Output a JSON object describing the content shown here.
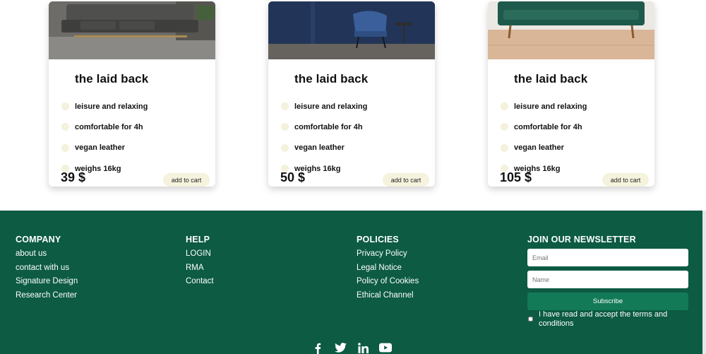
{
  "products": [
    {
      "title": "the laid back",
      "features": [
        "leisure and relaxing",
        "comfortable for 4h",
        "vegan leather",
        "weighs 16kg"
      ],
      "price": "39 $",
      "cart_label": "add to cart"
    },
    {
      "title": "the laid back",
      "features": [
        "leisure and relaxing",
        "comfortable for 4h",
        "vegan leather",
        "weighs 16kg"
      ],
      "price": "50 $",
      "cart_label": "add to cart"
    },
    {
      "title": "the laid back",
      "features": [
        "leisure and relaxing",
        "comfortable for 4h",
        "vegan leather",
        "weighs 16kg"
      ],
      "price": "105 $",
      "cart_label": "add to cart"
    }
  ],
  "footer": {
    "company": {
      "heading": "COMPANY",
      "links": [
        "about us",
        "contact with us",
        "Signature Design",
        "Research Center"
      ]
    },
    "help": {
      "heading": "HELP",
      "links": [
        "LOGIN",
        "RMA",
        "Contact"
      ]
    },
    "policies": {
      "heading": "POLICIES",
      "links": [
        "Privacy Policy",
        "Legal Notice",
        "Policy of Cookies",
        "Ethical Channel"
      ]
    },
    "newsletter": {
      "heading": "JOIN OUR NEWSLETTER",
      "email_placeholder": "Email",
      "name_placeholder": "Name",
      "subscribe_label": "Subscribe",
      "terms_text": "I have read and accept the terms and conditions"
    },
    "socials": [
      "facebook-icon",
      "twitter-icon",
      "linkedin-icon",
      "youtube-icon"
    ]
  },
  "colors": {
    "footer_bg": "#0c5b42",
    "button_green": "#137a58",
    "cart_button_bg": "#f5f3dd"
  }
}
